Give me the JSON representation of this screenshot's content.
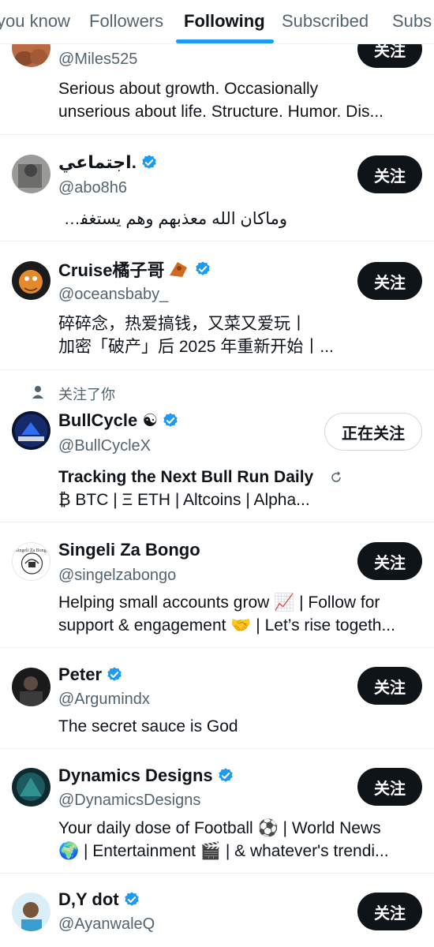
{
  "tabs": [
    {
      "label": "you know"
    },
    {
      "label": "Followers"
    },
    {
      "label": "Following"
    },
    {
      "label": "Subscribed"
    },
    {
      "label": "Subs"
    }
  ],
  "follow_label": "关注",
  "following_label": "正在关注",
  "follows_you_label": "关注了你",
  "accounts": [
    {
      "name": "",
      "handle": "@Miles525",
      "bio1": "Serious about growth. Occasionally",
      "bio2": "unserious about life.  Structure. Humor. Dis...",
      "verified": false
    },
    {
      "name": "اجتماعي.",
      "handle": "@abo8h6",
      "bio1": "وماكان الله معذبهم وهم يستغفرون..",
      "verified": true
    },
    {
      "name": "Cruise橘子哥",
      "handle": "@oceansbaby_",
      "bio1": "碎碎念，热爱搞钱，又菜又爱玩丨",
      "bio2": "加密「破产」后 2025 年重新开始丨...",
      "verified": true
    },
    {
      "name": "BullCycle ☯",
      "handle": "@BullCycleX",
      "bio1": "Tracking the Next Bull Run Daily",
      "bio2": "₿ BTC | Ξ ETH | Altcoins | Alpha...",
      "verified": true
    },
    {
      "name": "Singeli Za Bongo",
      "handle": "@singelzabongo",
      "bio1": "Helping small accounts grow 📈 | Follow for",
      "bio2": "support & engagement 🤝 | Let’s rise togeth...",
      "verified": false
    },
    {
      "name": "Peter",
      "handle": "@Argumindx",
      "bio1": "The secret sauce is God",
      "verified": true
    },
    {
      "name": "Dynamics Designs",
      "handle": "@DynamicsDesigns",
      "bio1": "Your daily dose of Football ⚽ | World News",
      "bio2": "🌍 | Entertainment 🎬 | & whatever's trendi...",
      "verified": true
    },
    {
      "name": "D,Y dot",
      "handle": "@AyanwaleQ",
      "verified": true
    }
  ],
  "avatar_label": "Singeli Za Bongo",
  "colors": {
    "accent": "#1d9bf0",
    "text": "#0f1419",
    "secondary": "#536471",
    "button": "#0f1419"
  }
}
